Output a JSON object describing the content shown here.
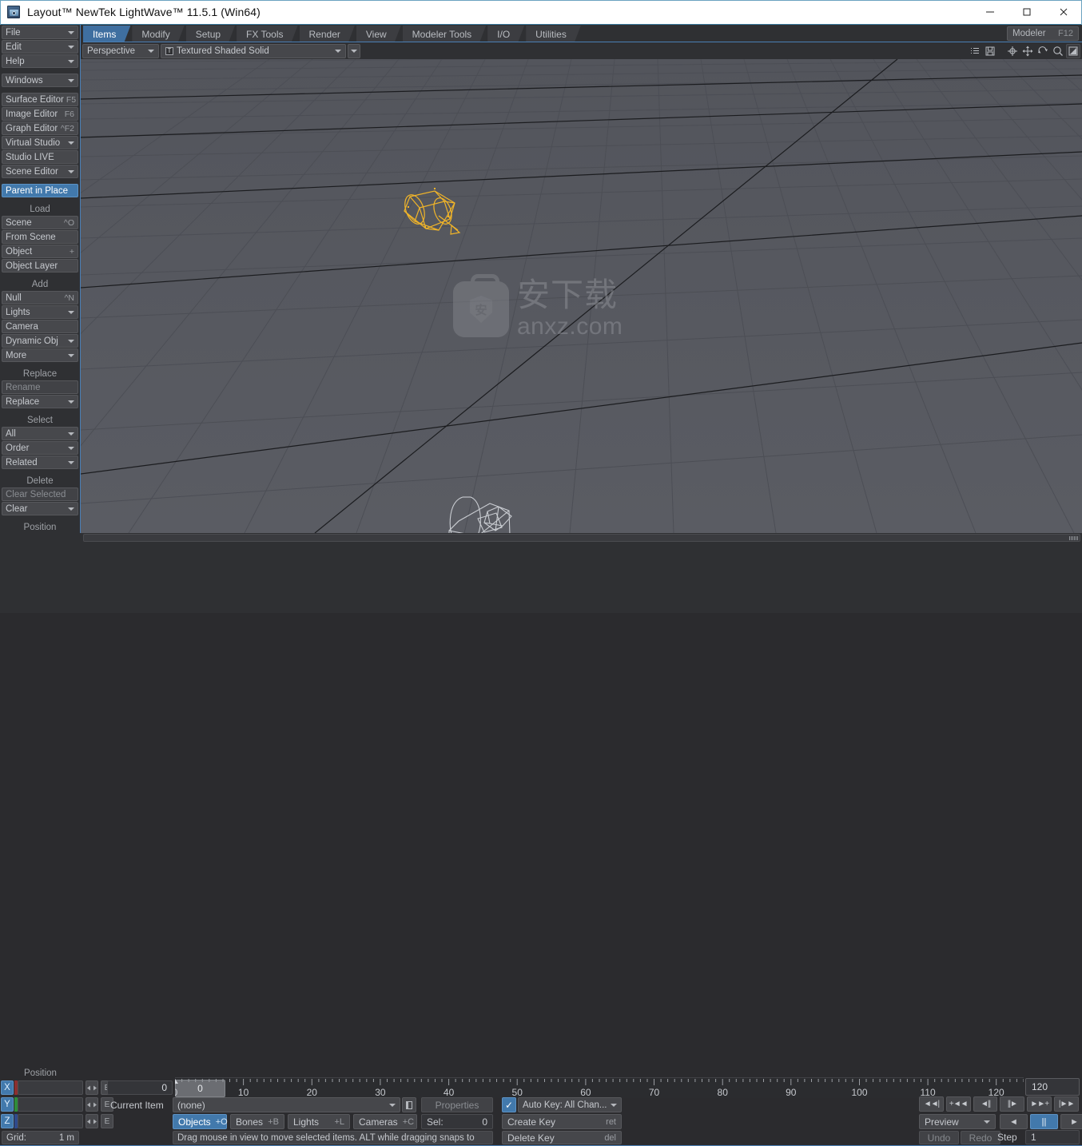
{
  "window": {
    "title": "Layout™ NewTek LightWave™ 11.5.1 (Win64)",
    "icon": "layout-app-icon",
    "minimize": "—",
    "maximize": "□",
    "close": "✕"
  },
  "tabs": [
    {
      "label": "Items",
      "active": true
    },
    {
      "label": "Modify",
      "active": false
    },
    {
      "label": "Setup",
      "active": false
    },
    {
      "label": "FX Tools",
      "active": false
    },
    {
      "label": "Render",
      "active": false
    },
    {
      "label": "View",
      "active": false
    },
    {
      "label": "Modeler Tools",
      "active": false
    },
    {
      "label": "I/O",
      "active": false
    },
    {
      "label": "Utilities",
      "active": false
    }
  ],
  "modeler_button": {
    "label": "Modeler",
    "hotkey": "F12"
  },
  "sidebar": {
    "groups": [
      {
        "header": null,
        "items": [
          {
            "label": "File",
            "hotkey": "",
            "type": "dropdown",
            "state": "normal"
          },
          {
            "label": "Edit",
            "hotkey": "",
            "type": "dropdown",
            "state": "normal"
          },
          {
            "label": "Help",
            "hotkey": "",
            "type": "dropdown",
            "state": "normal"
          }
        ]
      },
      {
        "header": null,
        "items": [
          {
            "label": "Windows",
            "hotkey": "",
            "type": "dropdown",
            "state": "normal"
          }
        ]
      },
      {
        "header": null,
        "items": [
          {
            "label": "Surface Editor",
            "hotkey": "F5",
            "type": "button",
            "state": "normal"
          },
          {
            "label": "Image Editor",
            "hotkey": "F6",
            "type": "button",
            "state": "normal"
          },
          {
            "label": "Graph Editor",
            "hotkey": "^F2",
            "type": "button",
            "state": "normal"
          },
          {
            "label": "Virtual Studio",
            "hotkey": "",
            "type": "dropdown",
            "state": "normal"
          },
          {
            "label": "Studio LIVE",
            "hotkey": "",
            "type": "button",
            "state": "normal"
          },
          {
            "label": "Scene Editor",
            "hotkey": "",
            "type": "dropdown",
            "state": "normal"
          }
        ]
      },
      {
        "header": null,
        "items": [
          {
            "label": "Parent in Place",
            "hotkey": "",
            "type": "button",
            "state": "selected"
          }
        ]
      },
      {
        "header": "Load",
        "items": [
          {
            "label": "Scene",
            "hotkey": "^O",
            "type": "button",
            "state": "normal"
          },
          {
            "label": "From Scene",
            "hotkey": "",
            "type": "button",
            "state": "normal"
          },
          {
            "label": "Object",
            "hotkey": "+",
            "type": "button",
            "state": "normal"
          },
          {
            "label": "Object Layer",
            "hotkey": "",
            "type": "button",
            "state": "normal"
          }
        ]
      },
      {
        "header": "Add",
        "items": [
          {
            "label": "Null",
            "hotkey": "^N",
            "type": "button",
            "state": "normal"
          },
          {
            "label": "Lights",
            "hotkey": "",
            "type": "dropdown",
            "state": "normal"
          },
          {
            "label": "Camera",
            "hotkey": "",
            "type": "button",
            "state": "normal"
          },
          {
            "label": "Dynamic Obj",
            "hotkey": "",
            "type": "dropdown",
            "state": "normal"
          },
          {
            "label": "More",
            "hotkey": "",
            "type": "dropdown",
            "state": "normal"
          }
        ]
      },
      {
        "header": "Replace",
        "items": [
          {
            "label": "Rename",
            "hotkey": "",
            "type": "button",
            "state": "disabled"
          },
          {
            "label": "Replace",
            "hotkey": "",
            "type": "dropdown",
            "state": "normal"
          }
        ]
      },
      {
        "header": "Select",
        "items": [
          {
            "label": "All",
            "hotkey": "",
            "type": "dropdown",
            "state": "normal"
          },
          {
            "label": "Order",
            "hotkey": "",
            "type": "dropdown",
            "state": "normal"
          },
          {
            "label": "Related",
            "hotkey": "",
            "type": "dropdown",
            "state": "normal"
          }
        ]
      },
      {
        "header": "Delete",
        "items": [
          {
            "label": "Clear Selected",
            "hotkey": "",
            "type": "button",
            "state": "disabled"
          },
          {
            "label": "Clear",
            "hotkey": "",
            "type": "dropdown",
            "state": "normal"
          }
        ]
      },
      {
        "header": "Position",
        "items": []
      }
    ]
  },
  "viewport": {
    "view_mode": "Perspective",
    "shading_mode": "Textured Shaded Solid",
    "shading_badge": "T",
    "icons": [
      "list-icon",
      "save-icon",
      "center-target-icon",
      "move-icon",
      "rotate-icon",
      "zoom-magnifier-icon",
      "maximize-viewport-icon"
    ],
    "watermark": {
      "chinese": "安下载",
      "latin": "anxz.com",
      "shield_glyph": "安"
    }
  },
  "position": {
    "label": "Position",
    "axes": [
      {
        "name": "X",
        "value": "",
        "color": "#8c2f2f"
      },
      {
        "name": "Y",
        "value": "",
        "color": "#2f8c3a"
      },
      {
        "name": "Z",
        "value": "",
        "color": "#2f4a8c"
      }
    ],
    "edit_label": "E",
    "grid_label": "Grid:",
    "grid_value": "1 m"
  },
  "timeline": {
    "current_frame": "0",
    "slider_value": "0",
    "end_frame": "120",
    "ticks": [
      {
        "label": "0",
        "value": 0
      },
      {
        "label": "10",
        "value": 10
      },
      {
        "label": "20",
        "value": 20
      },
      {
        "label": "30",
        "value": 30
      },
      {
        "label": "40",
        "value": 40
      },
      {
        "label": "50",
        "value": 50
      },
      {
        "label": "60",
        "value": 60
      },
      {
        "label": "70",
        "value": 70
      },
      {
        "label": "80",
        "value": 80
      },
      {
        "label": "90",
        "value": 90
      },
      {
        "label": "100",
        "value": 100
      },
      {
        "label": "110",
        "value": 110
      },
      {
        "label": "120",
        "value": 120
      }
    ],
    "range_start": 0,
    "range_end": 124
  },
  "controls": {
    "current_item_label": "Current Item",
    "current_item_value": "(none)",
    "item_picker_icon": "item-list-icon",
    "properties_label": "Properties",
    "autokey_label": "Auto Key: All Chan...",
    "autokey_checked": true,
    "autokey_check_glyph": "✓",
    "selection_modes": [
      {
        "label": "Objects",
        "hotkey": "+O",
        "active": true
      },
      {
        "label": "Bones",
        "hotkey": "+B",
        "active": false
      },
      {
        "label": "Lights",
        "hotkey": "+L",
        "active": false
      },
      {
        "label": "Cameras",
        "hotkey": "+C",
        "active": false
      }
    ],
    "sel_label": "Sel:",
    "sel_value": "0",
    "create_key_label": "Create Key",
    "create_key_hotkey": "ret",
    "delete_key_label": "Delete Key",
    "delete_key_hotkey": "del",
    "hint": "Drag mouse in view to move selected items. ALT while dragging snaps to"
  },
  "transport": {
    "buttons": [
      {
        "name": "skip-to-start-icon",
        "glyph": "◄◄|"
      },
      {
        "name": "step-back-key-icon",
        "glyph": "+◄◄"
      },
      {
        "name": "step-back-frame-icon",
        "glyph": "◄||"
      },
      {
        "name": "step-forward-frame-icon",
        "glyph": "||►"
      },
      {
        "name": "step-forward-key-icon",
        "glyph": "►►+"
      },
      {
        "name": "skip-to-end-icon",
        "glyph": "|►►"
      }
    ],
    "preview_label": "Preview",
    "play_reverse": "◄",
    "pause": "||",
    "play_forward": "►",
    "pause_active": true,
    "undo_label": "Undo",
    "redo_label": "Redo",
    "step_label": "Step",
    "step_value": "1"
  },
  "colors": {
    "accent_blue": "#4279ac",
    "panel_bg": "#2f3033",
    "button_bg": "#46474b",
    "viewport_bg": "#55575e",
    "selected_object": "#f0b429",
    "titlebar_bg": "#ffffff"
  }
}
